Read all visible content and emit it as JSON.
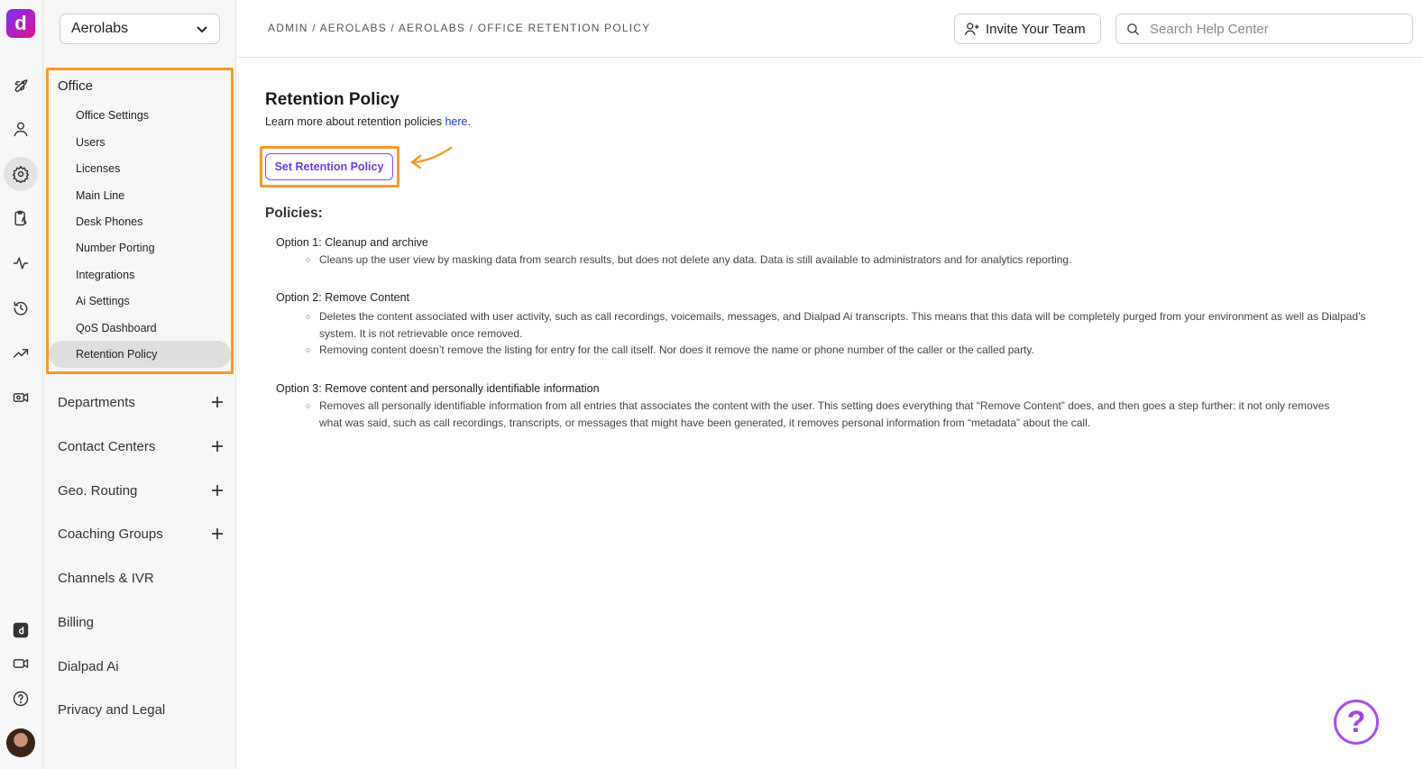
{
  "rail": {
    "logo": "d",
    "icons": [
      "rocket-icon",
      "user-icon",
      "gear-icon",
      "clipboard-icon",
      "activity-icon",
      "history-icon",
      "trending-icon",
      "video-icon"
    ],
    "bottom_icons": [
      "dialpad-app-icon",
      "meeting-icon",
      "help-icon"
    ]
  },
  "sidebar": {
    "org": "Aerolabs",
    "office_title": "Office",
    "office_items": [
      "Office Settings",
      "Users",
      "Licenses",
      "Main Line",
      "Desk Phones",
      "Number Porting",
      "Integrations",
      "Ai Settings",
      "QoS Dashboard",
      "Retention Policy"
    ],
    "active_item": "Retention Policy",
    "sections": [
      {
        "label": "Departments",
        "expandable": true
      },
      {
        "label": "Contact Centers",
        "expandable": true
      },
      {
        "label": "Geo. Routing",
        "expandable": true
      },
      {
        "label": "Coaching Groups",
        "expandable": true
      },
      {
        "label": "Channels & IVR",
        "expandable": false
      },
      {
        "label": "Billing",
        "expandable": false
      },
      {
        "label": "Dialpad Ai",
        "expandable": false
      },
      {
        "label": "Privacy and Legal",
        "expandable": false
      }
    ]
  },
  "header": {
    "breadcrumb": "ADMIN / AEROLABS / AEROLABS / OFFICE RETENTION POLICY",
    "invite_label": "Invite Your Team",
    "search_placeholder": "Search Help Center"
  },
  "main": {
    "title": "Retention Policy",
    "learn_prefix": "Learn more about retention policies ",
    "learn_link": "here",
    "learn_suffix": ".",
    "set_button": "Set Retention Policy",
    "policies_heading": "Policies:",
    "options": [
      {
        "title": "Option 1: Cleanup and archive",
        "bullets": [
          "Cleans up the user view by masking data from search results, but does not delete any data. Data is still available to administrators and for analytics reporting."
        ]
      },
      {
        "title": "Option 2: Remove Content",
        "bullets": [
          "Deletes the content associated with user activity, such as call recordings, voicemails, messages, and Dialpad Ai transcripts. This means that this data will be completely purged from your environment as well as Dialpad’s system. It is not retrievable once removed.",
          "Removing content doesn’t remove the listing for entry for the call itself. Nor does it remove the name or phone number of the caller or the called party."
        ]
      },
      {
        "title": "Option 3: Remove content and personally identifiable information",
        "bullets": [
          "Removes all personally identifiable information from all entries that associates the content with the user. This setting does everything that “Remove Content” does, and then goes a step further: it not only removes what was said, such as call recordings, transcripts, or messages that might have been generated, it removes personal information from “metadata” about the call."
        ]
      }
    ]
  },
  "help_fab": "?",
  "colors": {
    "highlight": "#f79a2e",
    "accent": "#7c4dff",
    "link": "#1a3ed6"
  }
}
